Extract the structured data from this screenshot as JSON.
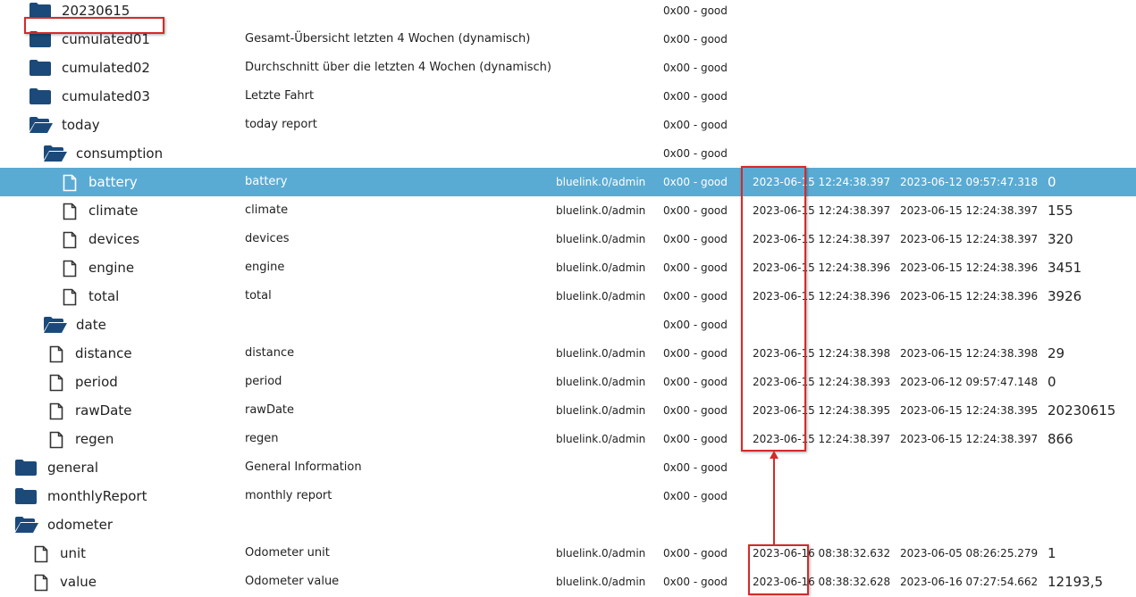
{
  "colors": {
    "folder": "#1b4a7a",
    "selected_row": "#5aabd3",
    "annotation": "#d42a2a"
  },
  "rows": [
    {
      "name": "20230615",
      "type": "folder",
      "level": 1,
      "desc": "",
      "user": "",
      "status": "0x00 - good",
      "ts": "",
      "lc": "",
      "value": ""
    },
    {
      "name": "cumulated01",
      "type": "folder",
      "level": 1,
      "desc": "Gesamt-Übersicht letzten 4 Wochen (dynamisch)",
      "user": "",
      "status": "0x00 - good",
      "ts": "",
      "lc": "",
      "value": ""
    },
    {
      "name": "cumulated02",
      "type": "folder",
      "level": 1,
      "desc": "Durchschnitt über die letzten 4 Wochen (dynamisch)",
      "user": "",
      "status": "0x00 - good",
      "ts": "",
      "lc": "",
      "value": ""
    },
    {
      "name": "cumulated03",
      "type": "folder",
      "level": 1,
      "desc": "Letzte Fahrt",
      "user": "",
      "status": "0x00 - good",
      "ts": "",
      "lc": "",
      "value": ""
    },
    {
      "name": "today",
      "type": "folder-open",
      "level": 1,
      "desc": "today report",
      "user": "",
      "status": "0x00 - good",
      "ts": "",
      "lc": "",
      "value": ""
    },
    {
      "name": "consumption",
      "type": "folder-open",
      "level": 2,
      "desc": "",
      "user": "",
      "status": "0x00 - good",
      "ts": "",
      "lc": "",
      "value": ""
    },
    {
      "name": "battery",
      "type": "file",
      "level": 3,
      "desc": "battery",
      "user": "bluelink.0/admin",
      "status": "0x00 - good",
      "ts": "2023-06-15 12:24:38.397",
      "lc": "2023-06-12 09:57:47.318",
      "value": "0",
      "selected": true
    },
    {
      "name": "climate",
      "type": "file",
      "level": 3,
      "desc": "climate",
      "user": "bluelink.0/admin",
      "status": "0x00 - good",
      "ts": "2023-06-15 12:24:38.397",
      "lc": "2023-06-15 12:24:38.397",
      "value": "155"
    },
    {
      "name": "devices",
      "type": "file",
      "level": 3,
      "desc": "devices",
      "user": "bluelink.0/admin",
      "status": "0x00 - good",
      "ts": "2023-06-15 12:24:38.397",
      "lc": "2023-06-15 12:24:38.397",
      "value": "320"
    },
    {
      "name": "engine",
      "type": "file",
      "level": 3,
      "desc": "engine",
      "user": "bluelink.0/admin",
      "status": "0x00 - good",
      "ts": "2023-06-15 12:24:38.396",
      "lc": "2023-06-15 12:24:38.396",
      "value": "3451"
    },
    {
      "name": "total",
      "type": "file",
      "level": 3,
      "desc": "total",
      "user": "bluelink.0/admin",
      "status": "0x00 - good",
      "ts": "2023-06-15 12:24:38.396",
      "lc": "2023-06-15 12:24:38.396",
      "value": "3926"
    },
    {
      "name": "date",
      "type": "folder-open",
      "level": 2,
      "desc": "",
      "user": "",
      "status": "0x00 - good",
      "ts": "",
      "lc": "",
      "value": ""
    },
    {
      "name": "distance",
      "type": "file",
      "level": 2,
      "desc": "distance",
      "user": "bluelink.0/admin",
      "status": "0x00 - good",
      "ts": "2023-06-15 12:24:38.398",
      "lc": "2023-06-15 12:24:38.398",
      "value": "29"
    },
    {
      "name": "period",
      "type": "file",
      "level": 2,
      "desc": "period",
      "user": "bluelink.0/admin",
      "status": "0x00 - good",
      "ts": "2023-06-15 12:24:38.393",
      "lc": "2023-06-12 09:57:47.148",
      "value": "0"
    },
    {
      "name": "rawDate",
      "type": "file",
      "level": 2,
      "desc": "rawDate",
      "user": "bluelink.0/admin",
      "status": "0x00 - good",
      "ts": "2023-06-15 12:24:38.395",
      "lc": "2023-06-15 12:24:38.395",
      "value": "20230615"
    },
    {
      "name": "regen",
      "type": "file",
      "level": 2,
      "desc": "regen",
      "user": "bluelink.0/admin",
      "status": "0x00 - good",
      "ts": "2023-06-15 12:24:38.397",
      "lc": "2023-06-15 12:24:38.397",
      "value": "866"
    },
    {
      "name": "general",
      "type": "folder",
      "level": 0,
      "desc": "General Information",
      "user": "",
      "status": "0x00 - good",
      "ts": "",
      "lc": "",
      "value": ""
    },
    {
      "name": "monthlyReport",
      "type": "folder",
      "level": 0,
      "desc": "monthly report",
      "user": "",
      "status": "0x00 - good",
      "ts": "",
      "lc": "",
      "value": ""
    },
    {
      "name": "odometer",
      "type": "folder-open",
      "level": 0,
      "desc": "",
      "user": "",
      "status": "",
      "ts": "",
      "lc": "",
      "value": ""
    },
    {
      "name": "unit",
      "type": "file",
      "level": 1,
      "desc": "Odometer unit",
      "user": "bluelink.0/admin",
      "status": "0x00 - good",
      "ts": "2023-06-16 08:38:32.632",
      "lc": "2023-06-05 08:26:25.279",
      "value": "1"
    },
    {
      "name": "value",
      "type": "file",
      "level": 1,
      "desc": "Odometer value",
      "user": "bluelink.0/admin",
      "status": "0x00 - good",
      "ts": "2023-06-16 08:38:32.628",
      "lc": "2023-06-16 07:27:54.662",
      "value": "12193,5"
    }
  ]
}
